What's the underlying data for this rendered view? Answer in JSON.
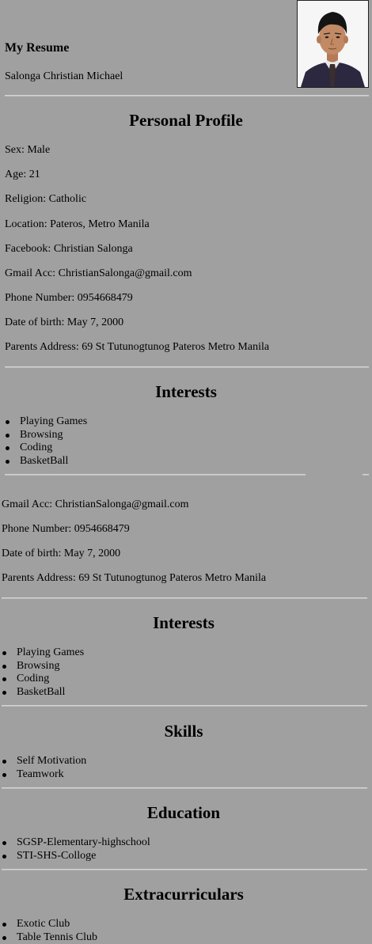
{
  "header": {
    "title": "My Resume",
    "name": "Salonga Christian Michael"
  },
  "profile": {
    "heading": "Personal Profile",
    "fields": [
      "Sex: Male",
      "Age: 21",
      "Religion: Catholic",
      "Location: Pateros, Metro Manila",
      "Facebook: Christian Salonga",
      "Gmail Acc: ChristianSalonga@gmail.com",
      "Phone Number: 0954668479",
      "Date of birth: May 7, 2000",
      "Parents Address: 69 St Tutunogtunog Pateros Metro Manila"
    ]
  },
  "interests": {
    "heading": "Interests",
    "items": [
      "Playing Games",
      "Browsing",
      "Coding",
      "BasketBall"
    ]
  },
  "repeat_profile": {
    "fields": [
      "Gmail Acc: ChristianSalonga@gmail.com",
      "Phone Number: 0954668479",
      "Date of birth: May 7, 2000",
      "Parents Address: 69 St Tutunogtunog Pateros Metro Manila"
    ]
  },
  "interests2": {
    "heading": "Interests",
    "items": [
      "Playing Games",
      "Browsing",
      "Coding",
      "BasketBall"
    ]
  },
  "skills": {
    "heading": "Skills",
    "items": [
      "Self Motivation",
      "Teamwork"
    ]
  },
  "education": {
    "heading": "Education",
    "items": [
      "SGSP-Elementary-highschool",
      "STI-SHS-Colloge"
    ]
  },
  "extracurriculars": {
    "heading": "Extracurriculars",
    "items": [
      "Exotic Club",
      "Table Tennis Club"
    ]
  }
}
